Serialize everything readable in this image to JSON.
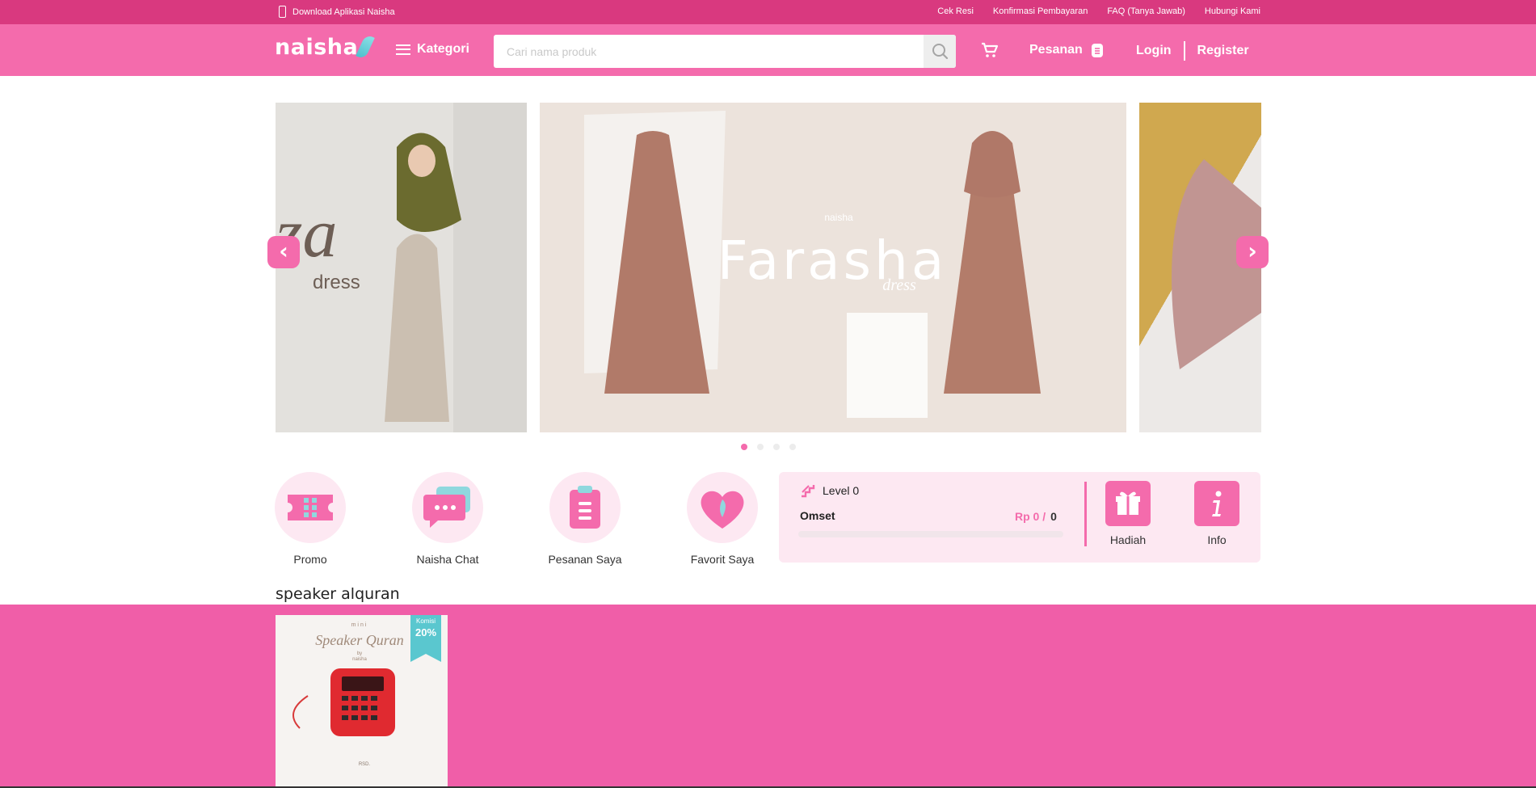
{
  "topbar": {
    "app_label": "Download Aplikasi Naisha",
    "links": [
      "Cek Resi",
      "Konfirmasi Pembayaran",
      "FAQ (Tanya Jawab)",
      "Hubungi Kami"
    ]
  },
  "header": {
    "logo": "naisha",
    "kategori": "Kategori",
    "search_placeholder": "Cari nama produk",
    "pesanan": "Pesanan",
    "login": "Login",
    "register": "Register"
  },
  "banners": {
    "slide1_text": "za",
    "slide1_sub": "dress",
    "slide2_brand": "naisha",
    "slide2_title": "Farasha",
    "slide2_sub": "dress"
  },
  "quick": [
    {
      "label": "Promo",
      "icon": "ticket-icon"
    },
    {
      "label": "Naisha Chat",
      "icon": "chat-icon"
    },
    {
      "label": "Pesanan Saya",
      "icon": "clipboard-icon"
    },
    {
      "label": "Favorit Saya",
      "icon": "heart-icon"
    }
  ],
  "member": {
    "level": "Level 0",
    "omset_label": "Omset",
    "omset_value": "Rp 0 /",
    "omset_target": "0",
    "progress": 0,
    "hadiah": "Hadiah",
    "info": "Info"
  },
  "section": {
    "title": "speaker alquran",
    "product": {
      "ribbon_label": "Komisi",
      "ribbon_value": "20%",
      "img_title": "mini",
      "img_script": "Speaker Quran",
      "img_by": "by",
      "img_brand": "naisha",
      "img_price": "RSD."
    }
  },
  "colors": {
    "primary": "#f46bac",
    "topbar": "#d9397f",
    "accent": "#5ac7cf"
  }
}
